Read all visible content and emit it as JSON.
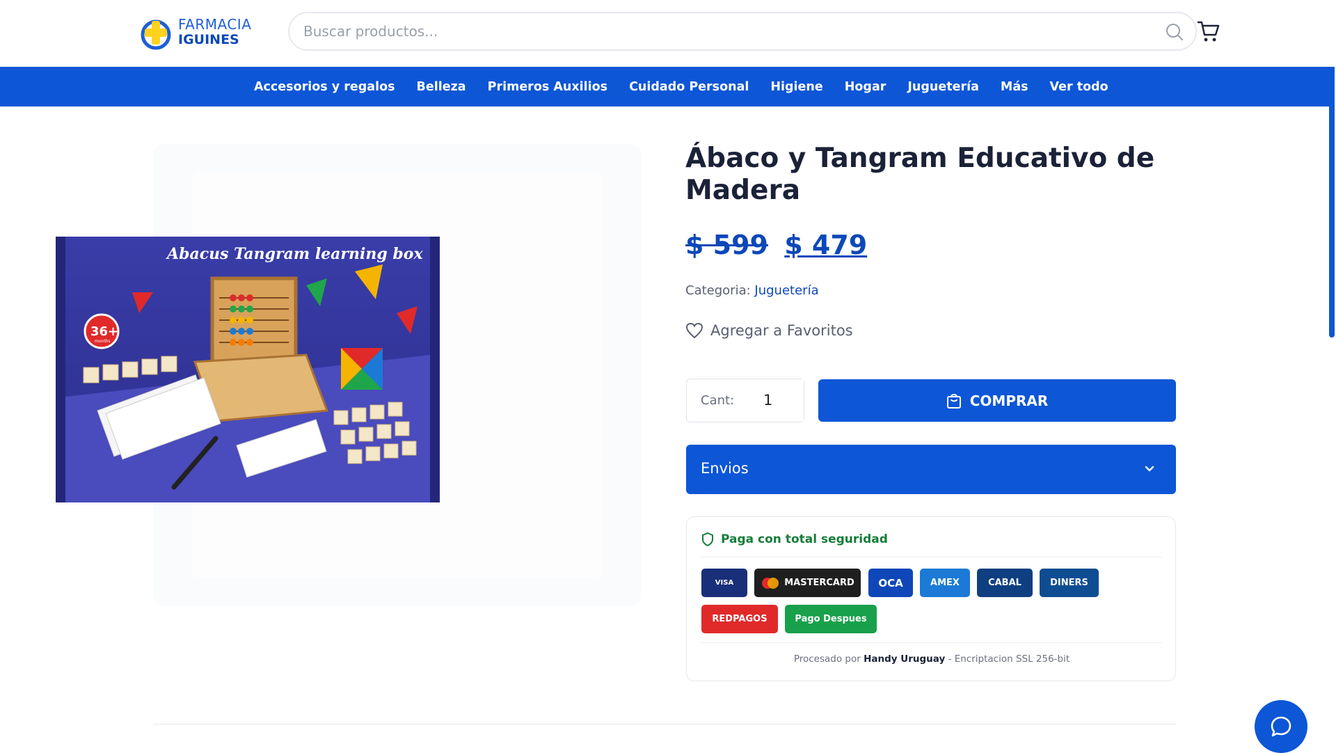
{
  "header": {
    "logo_line1": "FARMACIA",
    "logo_line2": "IGUINES",
    "search_placeholder": "Buscar productos..."
  },
  "nav": {
    "items": [
      "Accesorios y regalos",
      "Belleza",
      "Primeros Auxilios",
      "Cuidado Personal",
      "Higiene",
      "Hogar",
      "Juguetería",
      "Más",
      "Ver todo"
    ]
  },
  "product": {
    "title": "Ábaco y Tangram Educativo de Madera",
    "old_price": "$ 599",
    "price": "$ 479",
    "category_label": "Categoria:",
    "category_value": "Juguetería",
    "favorite_label": "Agregar a Favoritos",
    "qty_label": "Cant:",
    "qty_value": "1",
    "buy_label": "COMPRAR",
    "image_box_title": "Abacus Tangram learning box",
    "image_age_badge": "36+",
    "image_age_unit": "months"
  },
  "shipping": {
    "label": "Envios"
  },
  "payment": {
    "heading": "Paga con total seguridad",
    "methods": [
      {
        "label": "VISA",
        "color": "#1a2f7a"
      },
      {
        "label": "MASTERCARD",
        "color": "#1f1f1f"
      },
      {
        "label": "OCA",
        "color": "#0f47b8"
      },
      {
        "label": "AMEX",
        "color": "#1c7ad6"
      },
      {
        "label": "CABAL",
        "color": "#0f3f80"
      },
      {
        "label": "DINERS",
        "color": "#0f4d92"
      },
      {
        "label": "REDPAGOS",
        "color": "#e02a2a"
      },
      {
        "label": "Pago Despues",
        "color": "#18a04a"
      }
    ],
    "processed_prefix": "Procesado por",
    "processed_by": "Handy Uruguay",
    "processed_suffix": "- Encriptacion SSL 256-bit"
  },
  "colors": {
    "brand_blue": "#0d56d6",
    "price_blue": "#0d48b8",
    "secure_green": "#167d3a"
  }
}
